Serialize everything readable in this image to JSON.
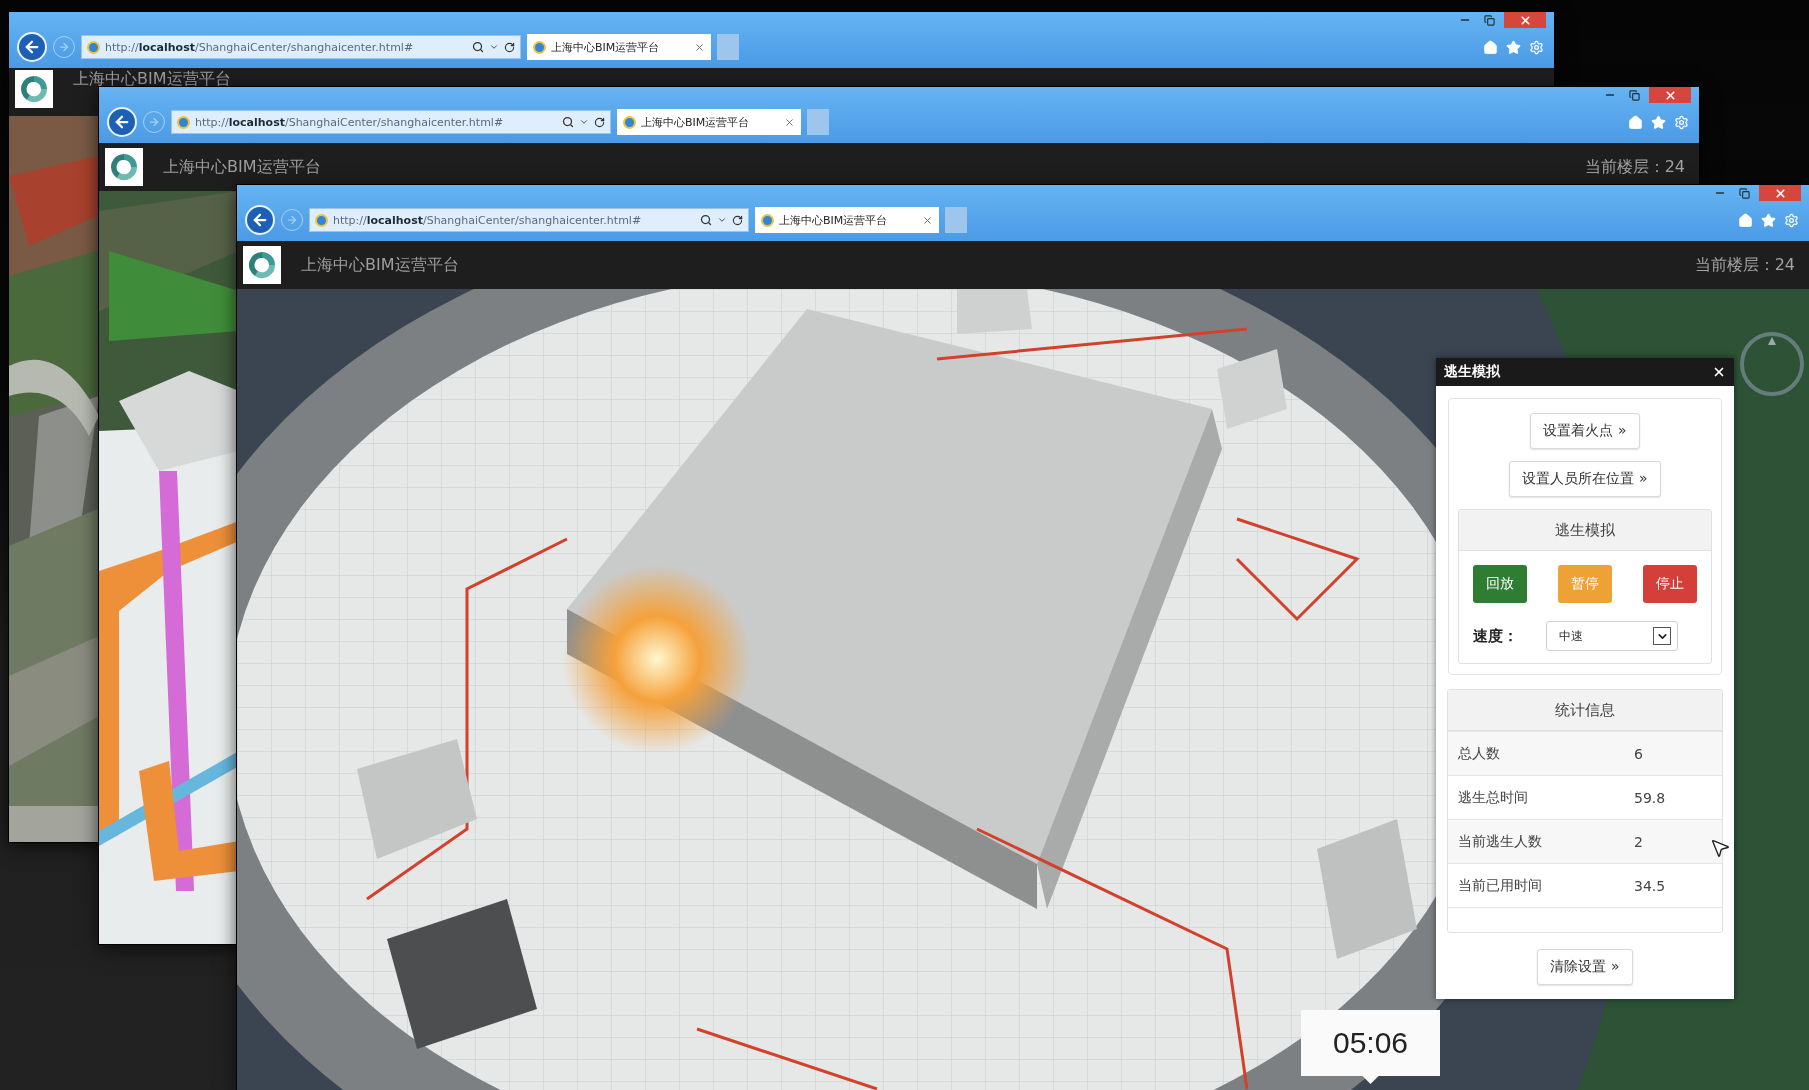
{
  "windows": [
    {
      "address": "http://**localhost**/ShanghaiCenter/shanghaicenter.html#",
      "tab_title": "上海中心BIM运营平台",
      "app_title": "上海中心BIM运营平台"
    },
    {
      "address": "http://**localhost**/ShanghaiCenter/shanghaicenter.html#",
      "tab_title": "上海中心BIM运营平台",
      "app_title": "上海中心BIM运营平台",
      "floor_label": "当前楼层：24"
    },
    {
      "address": "http://**localhost**/ShanghaiCenter/shanghaicenter.html#",
      "tab_title": "上海中心BIM运营平台",
      "app_title": "上海中心BIM运营平台",
      "floor_label": "当前楼层：24",
      "escape_panel": {
        "title": "逃生模拟",
        "setup_buttons": [
          "设置着火点 »",
          "设置人员所在位置 »"
        ],
        "simulation": {
          "header": "逃生模拟",
          "controls": [
            {
              "label": "回放",
              "color": "#2e7d32"
            },
            {
              "label": "暂停",
              "color": "#eea236"
            },
            {
              "label": "停止",
              "color": "#d43f3a"
            }
          ],
          "speed_label": "速度：",
          "speed_value": "中速"
        },
        "stats": {
          "header": "统计信息",
          "rows": [
            {
              "label": "总人数",
              "value": "6"
            },
            {
              "label": "逃生总时间",
              "value": "59.8"
            },
            {
              "label": "当前逃生人数",
              "value": "2"
            },
            {
              "label": "当前已用时间",
              "value": "34.5"
            }
          ]
        },
        "clear_button": "清除设置 »"
      },
      "timer": "05:06"
    }
  ]
}
